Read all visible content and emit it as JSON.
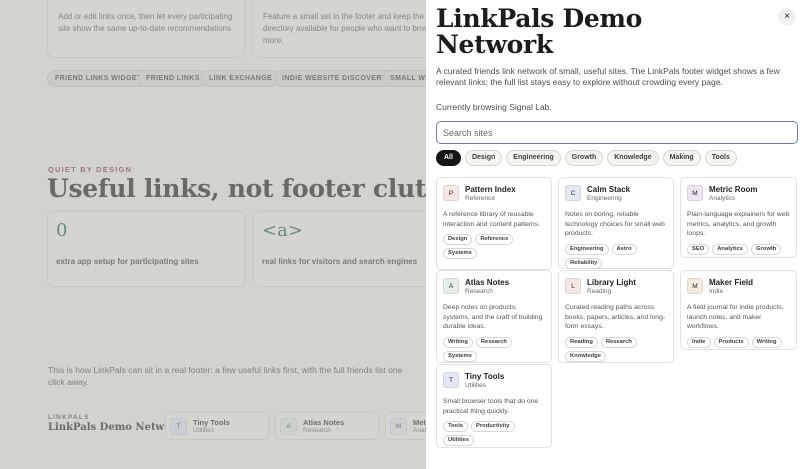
{
  "background": {
    "intro_cards": [
      {
        "text": "Add or edit links once, then let every participating site show the same up-to-date recommendations."
      },
      {
        "text": "Feature a small set in the footer and keep the full directory available for people who want to browse more."
      }
    ],
    "pills": [
      "FRIEND LINKS WIDGET",
      "FRIEND LINKS",
      "LINK EXCHANGE",
      "INDIE WEBSITE DISCOVERY",
      "SMALL WE"
    ],
    "eyebrow": "QUIET BY DESIGN",
    "heading": "Useful links, not footer clutter.",
    "stats": [
      {
        "value": "0",
        "label": "extra app setup for participating sites"
      },
      {
        "value": "<a>",
        "label": "real links for visitors and search engines"
      }
    ],
    "paragraph": "This is how LinkPals can sit in a real footer: a few useful links first, with the full friends list one click away.",
    "footer": {
      "eyebrow": "LINKPALS",
      "title": "LinkPals Demo Netw…",
      "cards": [
        {
          "initial": "T",
          "name": "Tiny Tools",
          "category": "Utilities",
          "color": "#e4e7f3"
        },
        {
          "initial": "A",
          "name": "Atlas Notes",
          "category": "Research",
          "color": "#e2efe7"
        },
        {
          "initial": "M",
          "name": "Metr",
          "category": "Anal",
          "color": "#ece6f2"
        }
      ]
    }
  },
  "panel": {
    "close_icon": "×",
    "title": "LinkPals Demo Network",
    "description": "A curated friends link network of small, useful sites. The LinkPals footer widget shows a few relevant links; the full list stays easy to explore without crowding every page.",
    "browsing": "Currently browsing Signal Lab.",
    "search_placeholder": "Search sites",
    "filters": [
      "All",
      "Design",
      "Engineering",
      "Growth",
      "Knowledge",
      "Making",
      "Tools"
    ],
    "sites": [
      {
        "initial": "P",
        "name": "Pattern Index",
        "category": "Reference",
        "color": "#f7e6e4",
        "description": "A reference library of reusable interaction and content patterns.",
        "tags": [
          "Design",
          "Reference",
          "Systems"
        ]
      },
      {
        "initial": "C",
        "name": "Calm Stack",
        "category": "Engineering",
        "color": "#e3e9f0",
        "description": "Notes on boring, reliable technology choices for small web products.",
        "tags": [
          "Engineering",
          "Astro",
          "Reliability"
        ]
      },
      {
        "initial": "M",
        "name": "Metric Room",
        "category": "Analytics",
        "color": "#ebe6f1",
        "description": "Plain-language explainers for web metrics, analytics, and growth loops.",
        "tags": [
          "SEO",
          "Analytics",
          "Growth"
        ]
      },
      {
        "initial": "A",
        "name": "Atlas Notes",
        "category": "Research",
        "color": "#e3efe7",
        "description": "Deep notes on products, systems, and the craft of building durable ideas.",
        "tags": [
          "Writing",
          "Research",
          "Systems"
        ]
      },
      {
        "initial": "L",
        "name": "Library Light",
        "category": "Reading",
        "color": "#f3e8e2",
        "description": "Curated reading paths across books, papers, articles, and long-form essays.",
        "tags": [
          "Reading",
          "Research",
          "Knowledge"
        ]
      },
      {
        "initial": "M",
        "name": "Maker Field",
        "category": "Indie",
        "color": "#f4ebdd",
        "description": "A field journal for indie products, launch notes, and maker workflows.",
        "tags": [
          "Indie",
          "Products",
          "Writing"
        ]
      },
      {
        "initial": "T",
        "name": "Tiny Tools",
        "category": "Utilities",
        "color": "#e4e8f5",
        "description": "Small browser tools that do one practical thing quickly.",
        "tags": [
          "Tools",
          "Productivity",
          "Utilities"
        ]
      }
    ]
  }
}
